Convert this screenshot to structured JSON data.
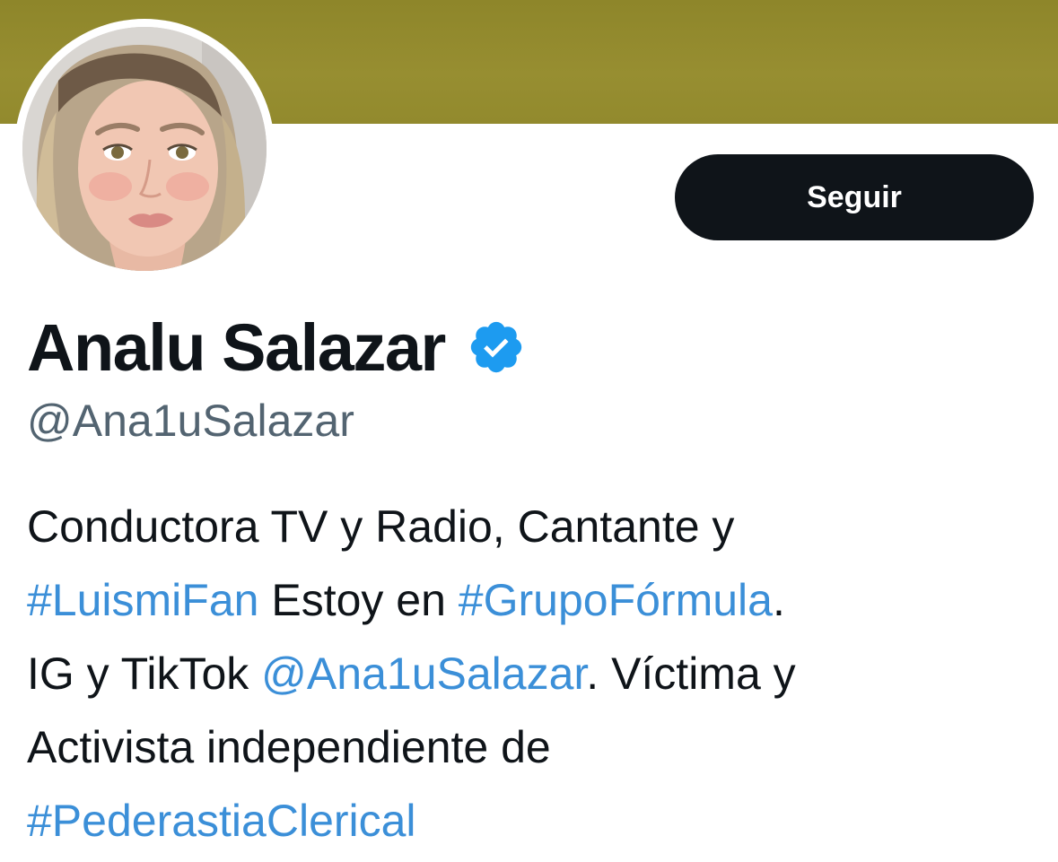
{
  "profile": {
    "display_name": "Analu Salazar",
    "handle": "@Ana1uSalazar",
    "verified": true,
    "follow_label": "Seguir",
    "banner_color": "#938b2e",
    "link_color": "#3b8fd8",
    "verified_color": "#1d9bf0",
    "bio": {
      "l1_text": "Conductora TV y Radio, Cantante y",
      "l2_tag1": "#LuismiFan",
      "l2_text": " Estoy en ",
      "l2_tag2": "#GrupoFórmula",
      "l2_end": ".",
      "l3_text": "IG y TikTok ",
      "l3_mention": "@Ana1uSalazar",
      "l3_end": ". Víctima y",
      "l4_text": "Activista independiente de",
      "l5_tag": "#PederastiaClerical"
    }
  }
}
